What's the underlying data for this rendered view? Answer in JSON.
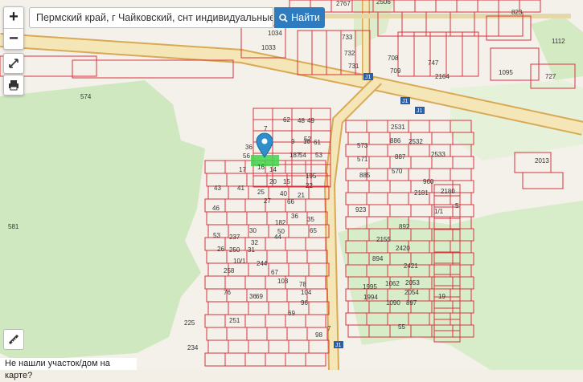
{
  "search": {
    "value": "Пермский край, г Чайковский, снт индивидуальные участки",
    "button_label": "Найти"
  },
  "zoom": {
    "in_label": "+",
    "out_label": "−"
  },
  "footer": {
    "text": "Не нашли участок/дом на карте?"
  },
  "road_labels": [
    "J1",
    "J1",
    "J1",
    "J1"
  ],
  "parcel_labels": [
    "2767",
    "2506",
    "823",
    "1034",
    "1033",
    "733",
    "732",
    "731",
    "708",
    "709",
    "747",
    "2164",
    "1095",
    "727",
    "574",
    "581",
    "7",
    "36",
    "56",
    "16",
    "17",
    "41",
    "25",
    "62",
    "48",
    "49",
    "9",
    "10",
    "54",
    "53",
    "15",
    "14",
    "195",
    "187",
    "61",
    "52",
    "20",
    "22",
    "40",
    "21",
    "43",
    "46",
    "27",
    "66",
    "182",
    "50",
    "237",
    "30",
    "53",
    "32",
    "44",
    "36",
    "35",
    "65",
    "26",
    "250",
    "31",
    "258",
    "10/1",
    "244",
    "67",
    "76",
    "69",
    "103",
    "78",
    "104",
    "96",
    "69",
    "36",
    "234",
    "251",
    "225",
    "573",
    "886",
    "571",
    "885",
    "887",
    "570",
    "2531",
    "2532",
    "2533",
    "960",
    "2181",
    "2180",
    "5",
    "892",
    "1/1",
    "923",
    "894",
    "2420",
    "2155",
    "2421",
    "2053",
    "2054",
    "1995",
    "1994",
    "1062",
    "897",
    "1090",
    "7",
    "19",
    "55",
    "98",
    "2013",
    "1112"
  ],
  "marker": {
    "label": "parcel-marker"
  },
  "colors": {
    "parcel_border": "#d9343d",
    "road": "#f5e6b8",
    "road_edge": "#d9a955",
    "forest": "#cfe8c0",
    "selected": "#3ed64c",
    "marker": "#2f8fcc"
  }
}
